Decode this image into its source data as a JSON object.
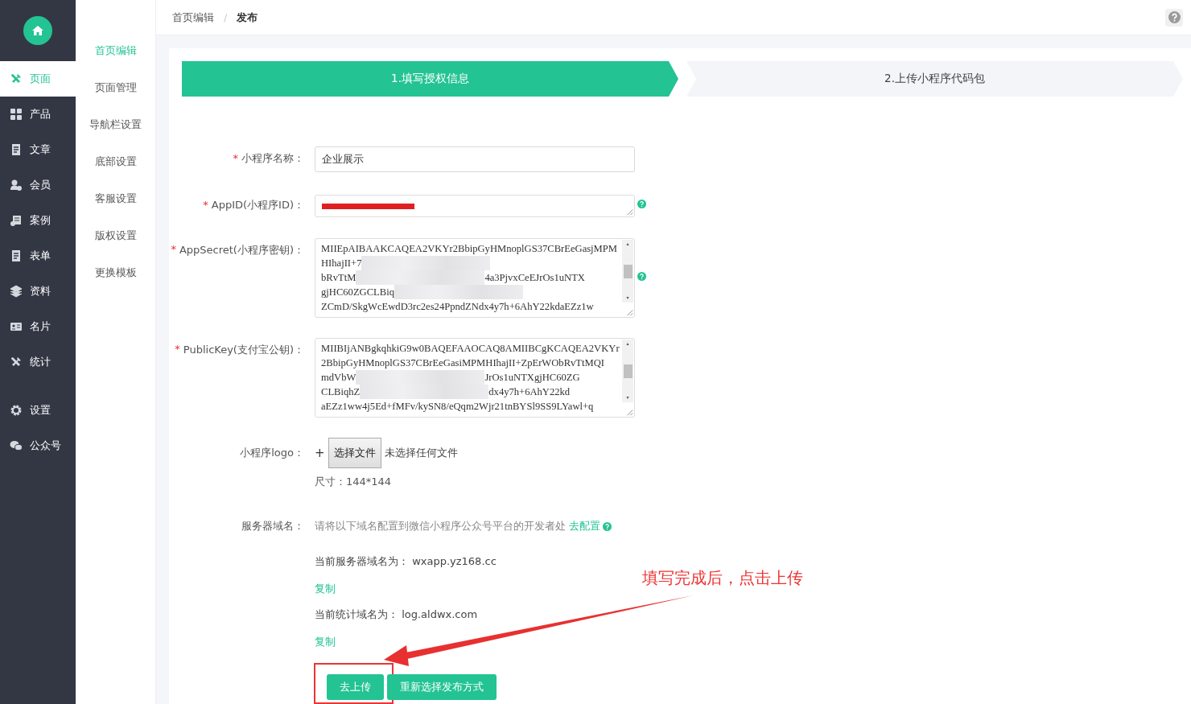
{
  "sidebar": {
    "items": [
      {
        "label": "页面",
        "kind": "tools",
        "selected": true
      },
      {
        "label": "产品",
        "kind": "grid",
        "selected": false
      },
      {
        "label": "文章",
        "kind": "doc",
        "selected": false
      },
      {
        "label": "会员",
        "kind": "user",
        "selected": false
      },
      {
        "label": "案例",
        "kind": "case",
        "selected": false
      },
      {
        "label": "表单",
        "kind": "doc",
        "selected": false
      },
      {
        "label": "资料",
        "kind": "layers",
        "selected": false
      },
      {
        "label": "名片",
        "kind": "card",
        "selected": false
      },
      {
        "label": "统计",
        "kind": "tools",
        "selected": false
      }
    ],
    "bottom_items": [
      {
        "label": "设置",
        "kind": "gear",
        "selected": false
      },
      {
        "label": "公众号",
        "kind": "chat",
        "selected": false
      }
    ]
  },
  "submenu": {
    "items": [
      {
        "label": "首页编辑",
        "selected": true
      },
      {
        "label": "页面管理",
        "selected": false
      },
      {
        "label": "导航栏设置",
        "selected": false
      },
      {
        "label": "底部设置",
        "selected": false
      },
      {
        "label": "客服设置",
        "selected": false
      },
      {
        "label": "版权设置",
        "selected": false
      },
      {
        "label": "更换模板",
        "selected": false
      }
    ]
  },
  "breadcrumb_separator": "/",
  "breadcrumb": [
    {
      "label": "首页编辑",
      "current": false
    },
    {
      "label": "发布",
      "current": true
    }
  ],
  "steps": [
    {
      "label": "1.填写授权信息",
      "selected": true
    },
    {
      "label": "2.上传小程序代码包",
      "selected": false
    }
  ],
  "form": {
    "required_mark": "*",
    "fields": [
      {
        "kind": "input",
        "label": "小程序名称：",
        "required": true,
        "help": false,
        "value": "企业展示"
      },
      {
        "kind": "redacted",
        "label": "AppID(小程序ID)：",
        "required": true,
        "help": true
      },
      {
        "kind": "textarea",
        "label": "AppSecret(小程序密钥)：",
        "required": true,
        "help": true,
        "lines": [
          [
            "MIIEpAIBAAKCAQEA2VKYr2BbipGyHMnoplGS37CBrEeGasjMPM"
          ],
          [
            "HIhajII+7"
          ],
          [
            "bRvTtM",
            "4a3PjvxCeEJrOs1uNTX"
          ],
          [
            "gjHC60ZGCLBiq"
          ],
          [
            "ZCmD/SkgWcEwdD3rc2es24PpndZNdx4y7h+6AhY22kdaEZz1w"
          ]
        ]
      },
      {
        "kind": "textarea",
        "label": "PublicKey(支付宝公钥)：",
        "required": true,
        "help": false,
        "lines": [
          [
            "MIIBIjANBgkqhkiG9w0BAQEFAAOCAQ8AMIIBCgKCAQEA2VKYr"
          ],
          [
            "2BbipGyHMnoplGS37CBrEeGasiMPMHIhajII+ZpErWObRvTtMQI"
          ],
          [
            "mdVbW",
            "JrOs1uNTXgjHC60ZG"
          ],
          [
            "CLBiqhZ",
            "dx4y7h+6AhY22kd"
          ],
          [
            "aEZz1ww4j5Ed+fMFv/kySN8/eQqm2Wjr21tnBYSl9SS9LYawl+q"
          ]
        ]
      }
    ],
    "logo": {
      "label": "小程序logo：",
      "plus": "+",
      "button": "选择文件",
      "status": "未选择任何文件",
      "size": "尺寸：144*144"
    },
    "server": {
      "label": "服务器域名：",
      "hint": "请将以下域名配置到微信小程序公众号平台的开发者处",
      "link": "去配置",
      "help": true,
      "entries": [
        {
          "label": "当前服务器域名为：",
          "value": "wxapp.yz168.cc",
          "copy": "复制"
        },
        {
          "label": "当前统计域名为：",
          "value": "log.aldwx.com",
          "copy": "复制"
        }
      ]
    },
    "buttons": [
      {
        "label": "去上传",
        "highlighted": true
      },
      {
        "label": "重新选择发布方式",
        "highlighted": false
      }
    ]
  },
  "annotation": {
    "text": "填写完成后，点击上传"
  }
}
